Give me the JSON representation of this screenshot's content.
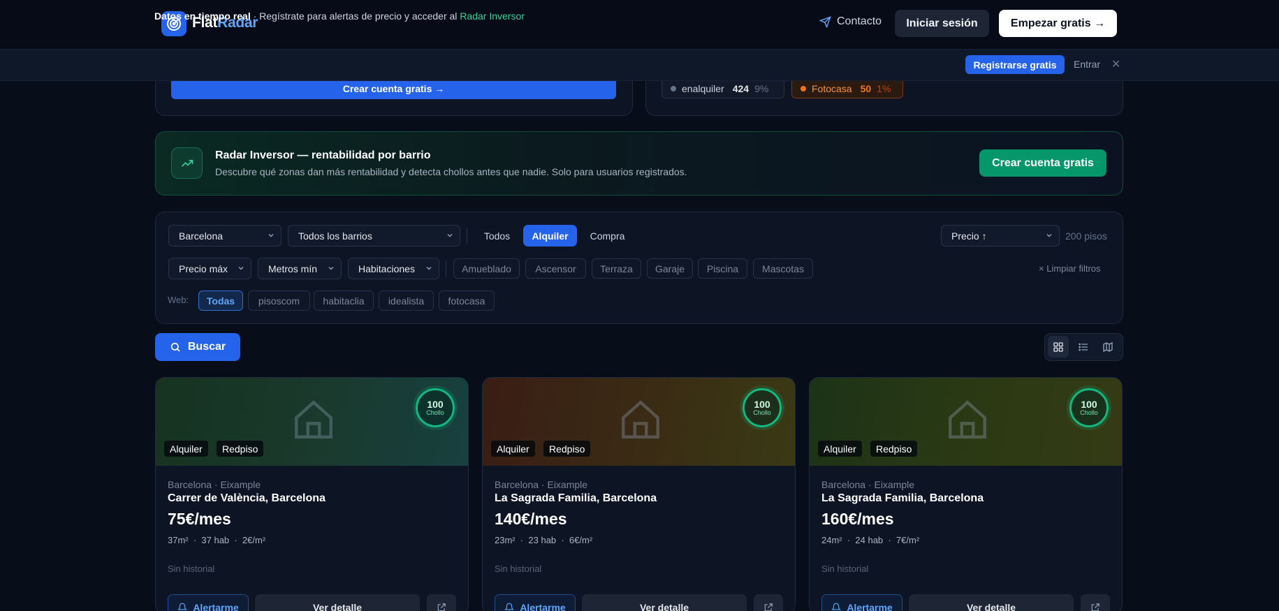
{
  "header": {
    "logo_flat": "Flat",
    "logo_radar": "Radar",
    "contact": "Contacto",
    "login": "Iniciar sesión",
    "start": "Empezar gratis →"
  },
  "banner": {
    "bold": "Datos en tiempo real",
    "text": " · Regístrate para alertas de precio y acceder al ",
    "link": "Radar Inversor",
    "register": "Registrarse gratis",
    "enter": "Entrar",
    "close": "✕"
  },
  "top_cards": {
    "create_account": "Crear cuenta gratis →",
    "sources": [
      {
        "name": "enalquiler",
        "count": "424",
        "pct": "9%",
        "color": "#64748b"
      },
      {
        "name": "Fotocasa",
        "count": "50",
        "pct": "1%",
        "color": "#f97316"
      }
    ]
  },
  "investor": {
    "title": "Radar Inversor — rentabilidad por barrio",
    "desc": "Descubre qué zonas dan más rentabilidad y detecta chollos antes que nadie. Solo para usuarios registrados.",
    "cta": "Crear cuenta gratis"
  },
  "filters": {
    "city": "Barcelona",
    "neighborhood": "Todos los barrios",
    "modes": [
      "Todos",
      "Alquiler",
      "Compra"
    ],
    "active_mode": "Alquiler",
    "sort": "Precio ↑",
    "count": "200 pisos",
    "price_max": "Precio máx",
    "meters_min": "Metros mín",
    "rooms": "Habitaciones",
    "features": [
      "Amueblado",
      "Ascensor",
      "Terraza",
      "Garaje",
      "Piscina",
      "Mascotas"
    ],
    "clear": "× Limpiar filtros",
    "web_label": "Web:",
    "webs": [
      "Todas",
      "pisoscom",
      "habitaclia",
      "idealista",
      "fotocasa"
    ],
    "active_web": "Todas"
  },
  "search": {
    "label": "Buscar"
  },
  "listings": [
    {
      "score": "100",
      "score_label": "Chollo",
      "type": "Alquiler",
      "source": "Redpiso",
      "meta": "Barcelona · Eixample",
      "title": "Carrer de València, Barcelona",
      "price": "75€/mes",
      "specs": "37m²  ·  37 hab  ·  2€/m²",
      "history": "Sin historial",
      "alert": "Alertarme",
      "detail": "Ver detalle",
      "hero_colors": [
        "#16331f",
        "#1a3a2e",
        "#174040"
      ]
    },
    {
      "score": "100",
      "score_label": "Chollo",
      "type": "Alquiler",
      "source": "Redpiso",
      "meta": "Barcelona · Eixample",
      "title": "La Sagrada Familia, Barcelona",
      "price": "140€/mes",
      "specs": "23m²  ·  23 hab  ·  6€/m²",
      "history": "Sin historial",
      "alert": "Alertarme",
      "detail": "Ver detalle",
      "hero_colors": [
        "#3a1d14",
        "#3a2c14",
        "#3a3a14"
      ]
    },
    {
      "score": "100",
      "score_label": "Chollo",
      "type": "Alquiler",
      "source": "Redpiso",
      "meta": "Barcelona · Eixample",
      "title": "La Sagrada Familia, Barcelona",
      "price": "160€/mes",
      "specs": "24m²  ·  24 hab  ·  7€/m²",
      "history": "Sin historial",
      "alert": "Alertarme",
      "detail": "Ver detalle",
      "hero_colors": [
        "#1d3316",
        "#2b3a14",
        "#353a14"
      ]
    }
  ]
}
